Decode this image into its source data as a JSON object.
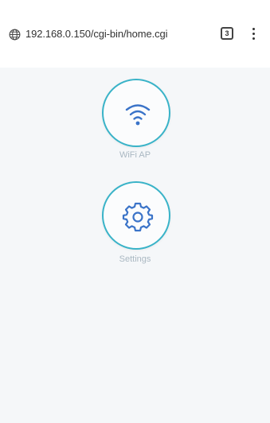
{
  "browser": {
    "url": "192.168.0.150/cgi-bin/home.cgi",
    "tab_count": "3",
    "icons": {
      "site_info": "globe-icon",
      "tabs": "tab-switcher-icon",
      "menu": "more-vert-icon"
    }
  },
  "tiles": [
    {
      "label": "WiFi AP",
      "icon": "wifi-icon"
    },
    {
      "label": "Settings",
      "icon": "gear-icon"
    }
  ],
  "colors": {
    "accent": "#3a73c8",
    "ring": "#39b3c8",
    "label": "#aab8c2",
    "background": "#f5f7f9"
  }
}
